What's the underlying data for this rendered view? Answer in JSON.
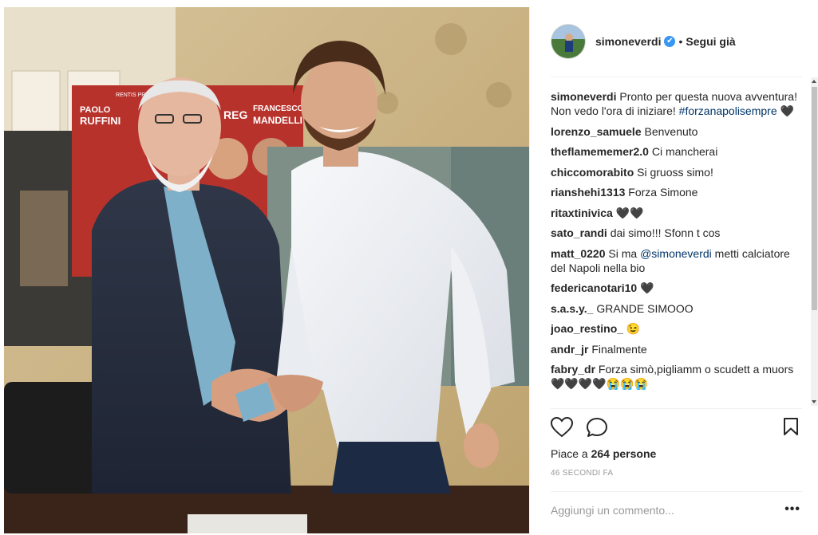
{
  "post": {
    "username": "simoneverdi",
    "verified_icon": "verified-badge-icon",
    "separator": "•",
    "follow_label": "Segui già",
    "caption": {
      "username": "simoneverdi",
      "text": "Pronto per questa nuova avventura! Non vedo l'ora di iniziare!",
      "hashtag": "#forzanapolisempre",
      "emoji": "🖤"
    },
    "comments": [
      {
        "user": "lorenzo_samuele",
        "text": "Benvenuto"
      },
      {
        "user": "theflamememer2.0",
        "text": "Ci mancherai"
      },
      {
        "user": "chiccomorabito",
        "text": "Si gruoss simo!"
      },
      {
        "user": "rianshehi1313",
        "text": "Forza Simone"
      },
      {
        "user": "ritaxtinivica",
        "text": "🖤🖤"
      },
      {
        "user": "sato_randi",
        "text": "dai simo!!! Sfonn t cos"
      },
      {
        "user": "matt_0220",
        "text_before": "Si ma",
        "mention": "@simoneverdi",
        "text_after": "metti calciatore del Napoli nella bio"
      },
      {
        "user": "federicanotari10",
        "text": "🖤"
      },
      {
        "user": "s.a.s.y._",
        "text": "GRANDE SIMOOO"
      },
      {
        "user": "joao_restino_",
        "text": "😉"
      },
      {
        "user": "andr_jr",
        "text": "Finalmente"
      },
      {
        "user": "fabry_dr",
        "text": "Forza simò,pigliamm o scudett a muors🖤🖤🖤🖤😭😭😭"
      }
    ],
    "likes_prefix": "Piace a",
    "likes_count": "264",
    "likes_suffix": "persone",
    "timestamp": "46 SECONDI FA",
    "add_comment_placeholder": "Aggiungi un commento...",
    "more_label": "•••",
    "photo_poster": {
      "left_name": "PAOLO\nRUFFINI",
      "mid_name": "REG",
      "right_name": "FRANCESCO\nMANDELLI",
      "top_text": "RENTIS PRESENTANO"
    }
  },
  "colors": {
    "accent_blue": "#3897f0",
    "link_blue": "#003569",
    "text": "#262626",
    "muted": "#999999"
  }
}
